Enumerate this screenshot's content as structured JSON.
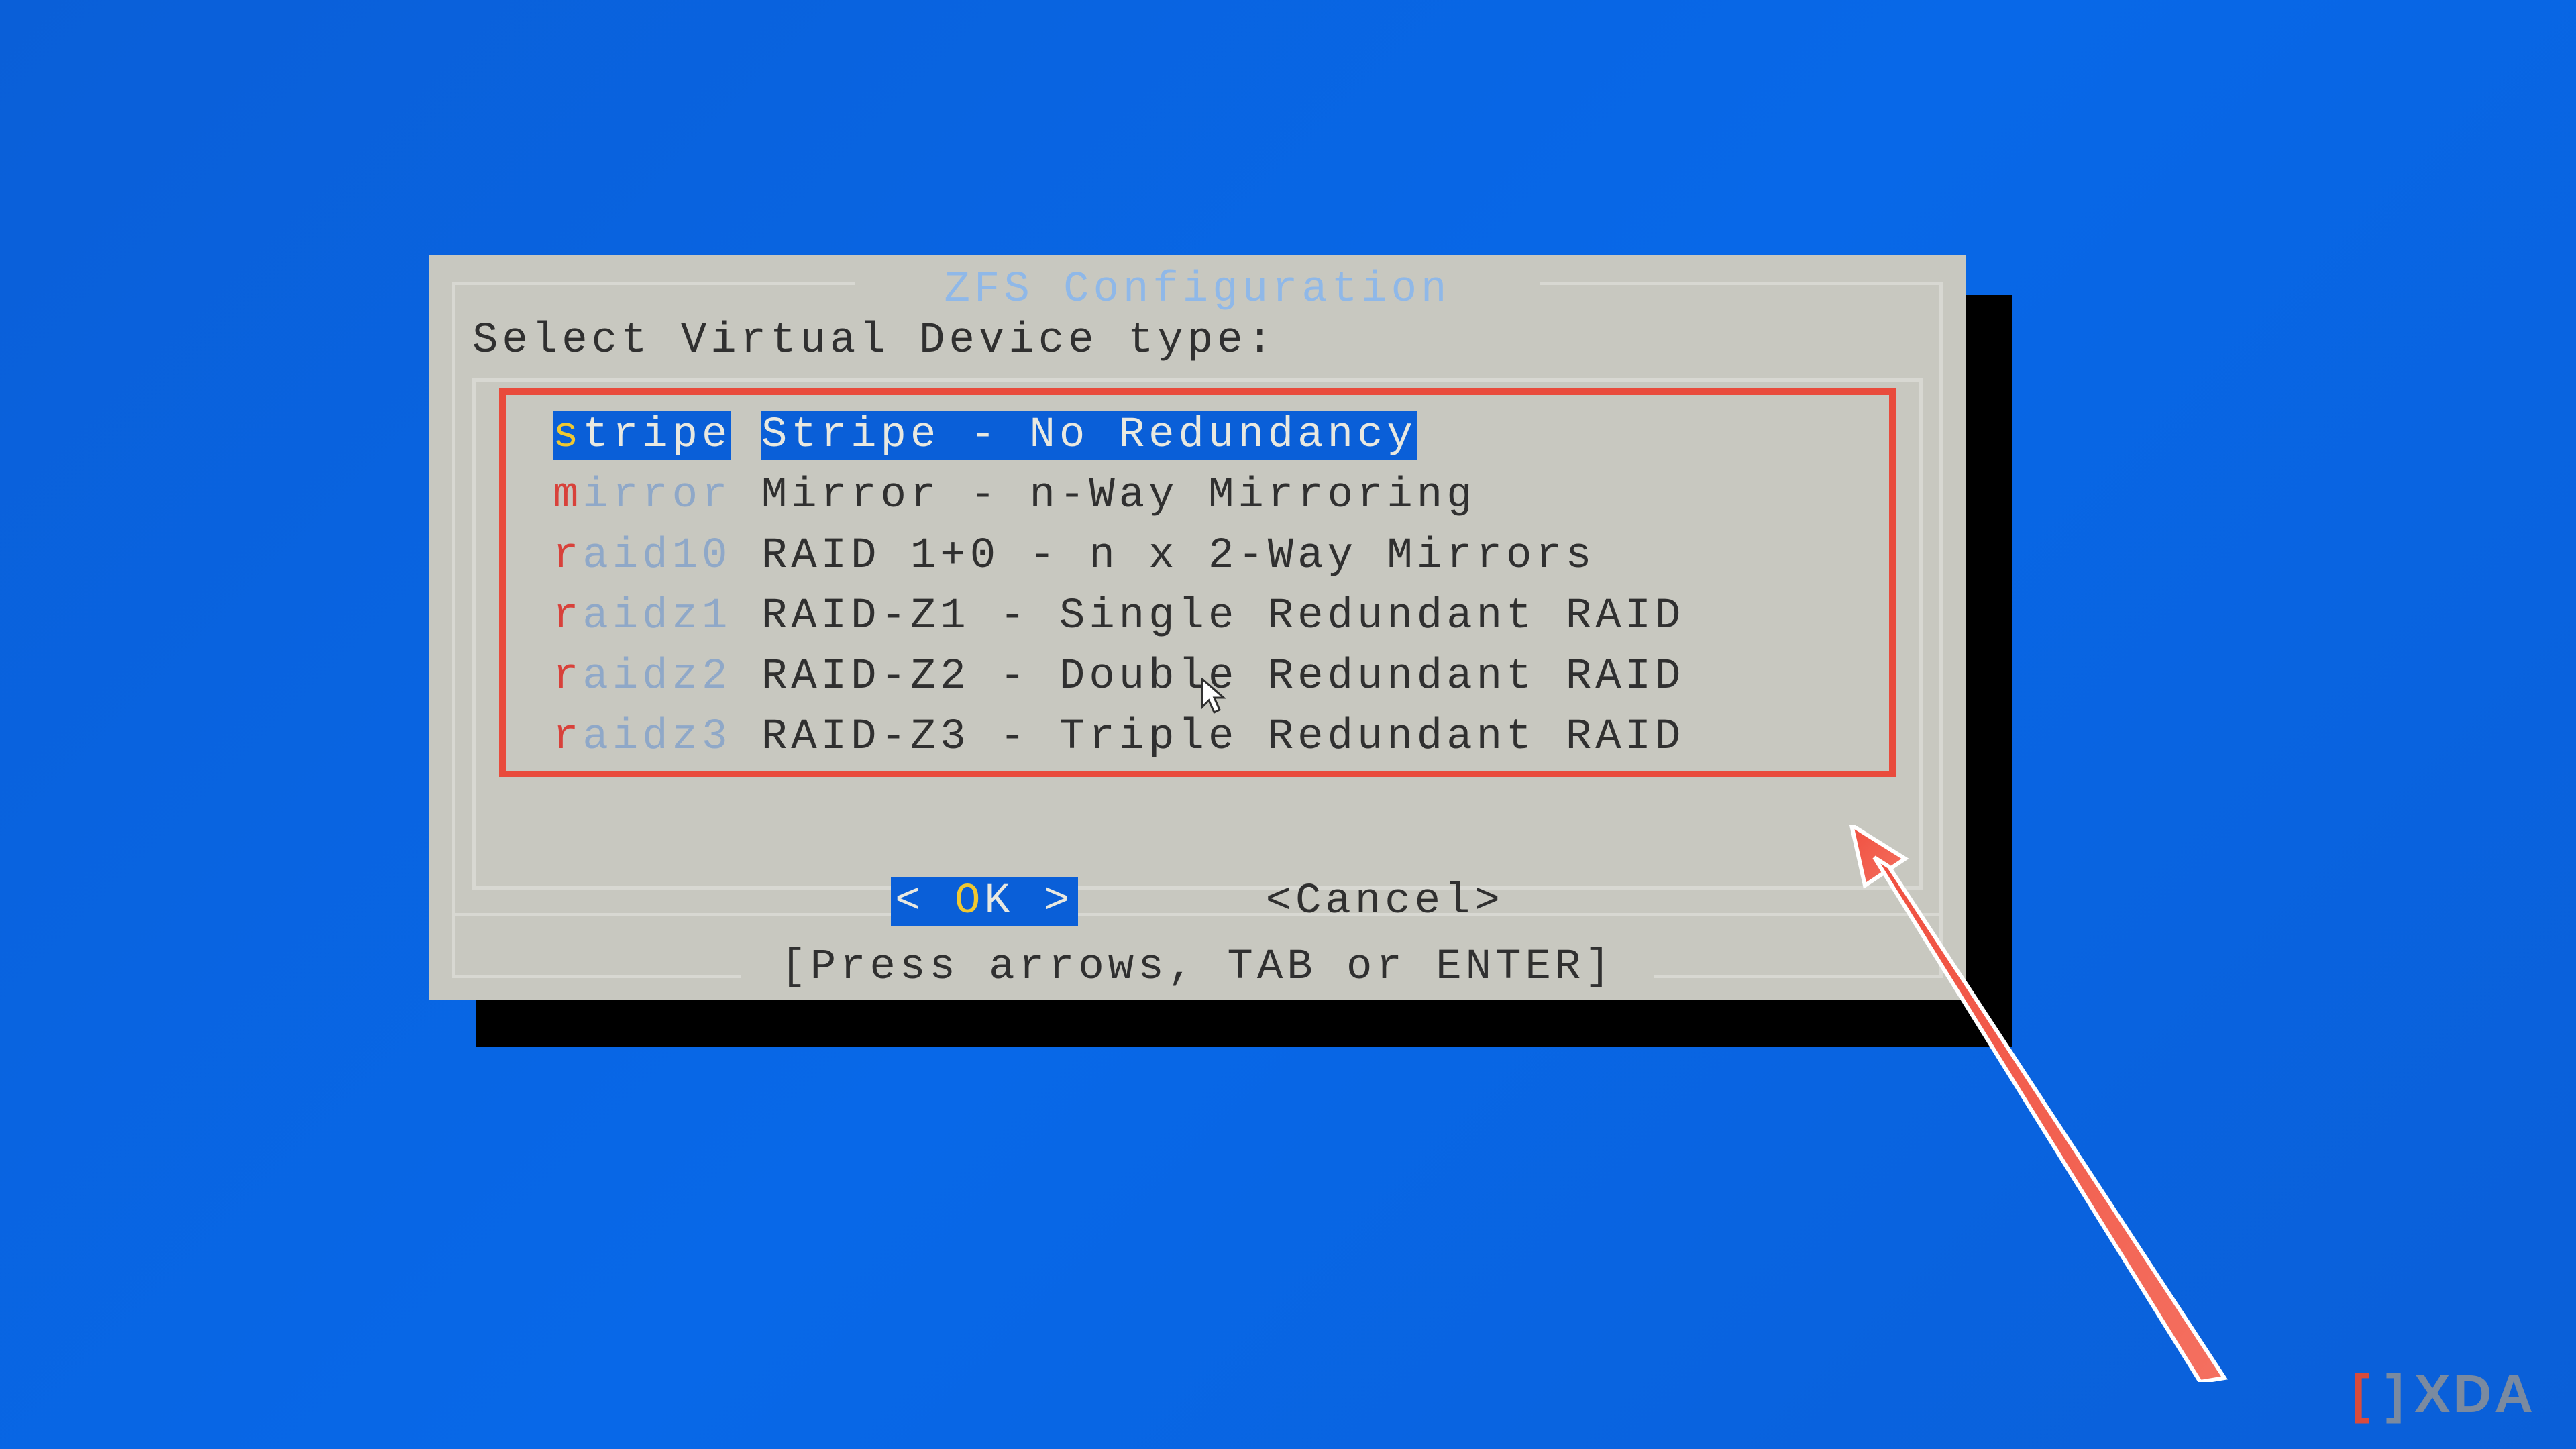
{
  "dialog": {
    "title": "ZFS Configuration",
    "prompt": "Select Virtual Device type:",
    "hint": "[Press arrows, TAB or ENTER]"
  },
  "menu": {
    "items": [
      {
        "hotkey": "s",
        "rest": "tripe",
        "desc": "Stripe - No Redundancy",
        "selected": true
      },
      {
        "hotkey": "m",
        "rest": "irror",
        "desc": "Mirror - n-Way Mirroring",
        "selected": false
      },
      {
        "hotkey": "r",
        "rest": "aid10",
        "desc": "RAID 1+0 - n x 2-Way Mirrors",
        "selected": false
      },
      {
        "hotkey": "r",
        "rest": "aidz1",
        "desc": "RAID-Z1 - Single Redundant RAID",
        "selected": false
      },
      {
        "hotkey": "r",
        "rest": "aidz2",
        "desc": "RAID-Z2 - Double Redundant RAID",
        "selected": false
      },
      {
        "hotkey": "r",
        "rest": "aidz3",
        "desc": "RAID-Z3 - Triple Redundant RAID",
        "selected": false
      }
    ]
  },
  "buttons": {
    "ok": {
      "left": "<  ",
      "hot": "O",
      "rest": "K  >"
    },
    "cancel": "<Cancel>"
  },
  "watermark": {
    "text": "XDA"
  },
  "annotation": {
    "highlight_color": "#e94b3c",
    "arrow_color": "#ef4a3a"
  }
}
